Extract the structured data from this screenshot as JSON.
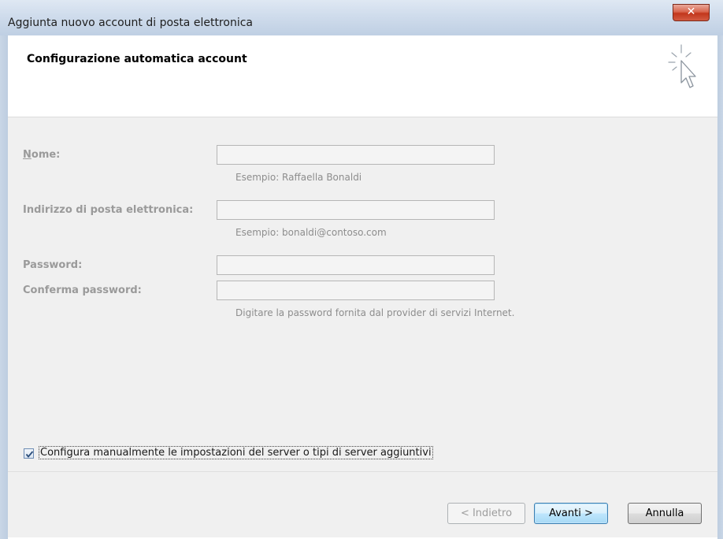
{
  "window": {
    "title": "Aggiunta nuovo account di posta elettronica",
    "close_glyph": "✕"
  },
  "header": {
    "title": "Configurazione automatica account",
    "icon": "cursor-sparkle-icon"
  },
  "form": {
    "name_label": "Nome:",
    "name_value": "",
    "name_example": "Esempio: Raffaella Bonaldi",
    "email_label": "Indirizzo di posta elettronica:",
    "email_value": "",
    "email_example": "Esempio: bonaldi@contoso.com",
    "password_label": "Password:",
    "password_value": "",
    "confirm_label": "Conferma password:",
    "confirm_value": "",
    "password_hint": "Digitare la password fornita dal provider di servizi Internet."
  },
  "manual_config": {
    "checked": true,
    "label": "Configura manualmente le impostazioni del server o tipi di server aggiuntivi"
  },
  "buttons": {
    "back": "< Indietro",
    "next": "Avanti >",
    "cancel": "Annulla"
  },
  "colors": {
    "titlebar": "#cfdcec",
    "close_button": "#c2361c",
    "default_button_border": "#3c7fb1",
    "disabled_text": "#9a9a9a"
  }
}
